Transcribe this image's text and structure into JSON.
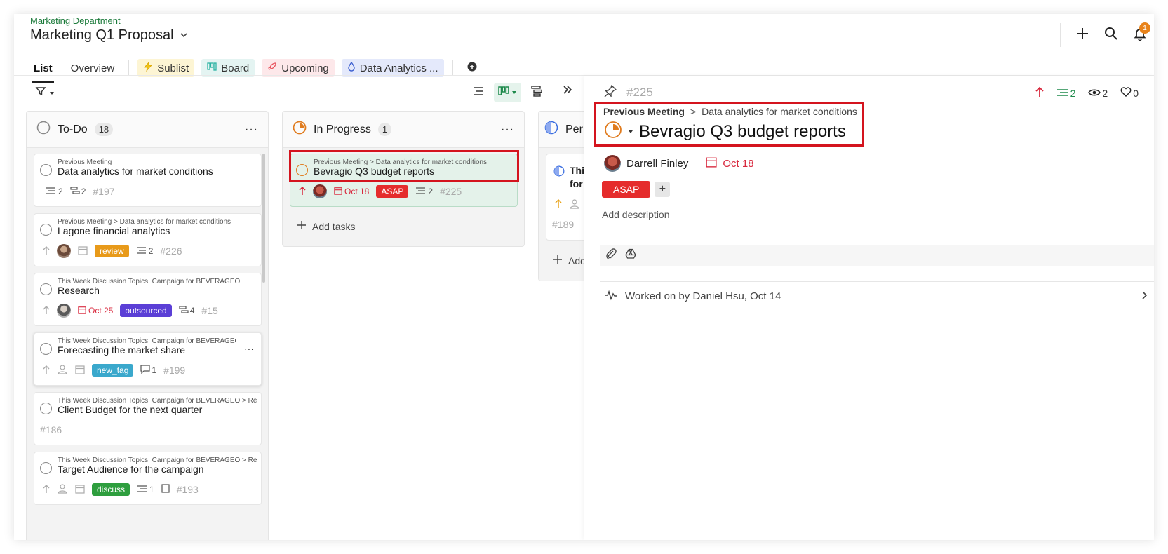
{
  "header": {
    "department": "Marketing Department",
    "project": "Marketing Q1 Proposal",
    "notification_count": "1"
  },
  "tabs": [
    {
      "label": "List"
    },
    {
      "label": "Overview"
    },
    {
      "label": "Sublist"
    },
    {
      "label": "Board"
    },
    {
      "label": "Upcoming"
    },
    {
      "label": "Data Analytics ..."
    }
  ],
  "columns": {
    "todo": {
      "title": "To-Do",
      "count": "18",
      "cards": [
        {
          "path": "Previous Meeting",
          "title": "Data analytics for market conditions",
          "subtasks": "2",
          "children": "2",
          "id": "#197"
        },
        {
          "path": "Previous Meeting > Data analytics for market conditions",
          "title": "Lagone financial analytics",
          "tag": "review",
          "subtasks": "2",
          "id": "#226"
        },
        {
          "path": "This Week Discussion Topics: Campaign for BEVERAGEO",
          "title": "Research",
          "date": "Oct 25",
          "tag": "outsourced",
          "children": "4",
          "id": "#15"
        },
        {
          "path": "This Week Discussion Topics: Campaign for BEVERAGEO > P...",
          "title": "Forecasting the market share",
          "tag": "new_tag",
          "comments": "1",
          "id": "#199"
        },
        {
          "path": "This Week Discussion Topics: Campaign for BEVERAGEO > Re...",
          "title": "Client Budget for the next quarter",
          "id": "#186"
        },
        {
          "path": "This Week Discussion Topics: Campaign for BEVERAGEO > Re...",
          "title": "Target Audience for the campaign",
          "tag": "discuss",
          "subtasks": "1",
          "id": "#193"
        }
      ]
    },
    "inprogress": {
      "title": "In Progress",
      "count": "1",
      "cards": [
        {
          "path": "Previous Meeting > Data analytics for market conditions",
          "title": "Bevragio Q3 budget reports",
          "date": "Oct 18",
          "tag": "ASAP",
          "subtasks": "2",
          "id": "#225"
        }
      ],
      "add_label": "Add tasks"
    },
    "pending": {
      "title": "Per",
      "card_title_line1": "Thi",
      "card_title_line2": "for",
      "card_id": "#189",
      "add_label": "Add"
    }
  },
  "detail": {
    "id": "#225",
    "subtasks": "2",
    "watchers": "2",
    "likes": "0",
    "crumb_parent": "Previous Meeting",
    "crumb_sep": ">",
    "crumb_task": "Data analytics for market conditions",
    "title": "Bevragio Q3 budget reports",
    "assignee": "Darrell Finley",
    "due": "Oct 18",
    "tag": "ASAP",
    "tag_add": "+",
    "description_placeholder": "Add description",
    "activity": "Worked on by Daniel Hsu, Oct 14"
  },
  "colors": {
    "department": "#1b7a3a",
    "review": "#e89a1a",
    "outsourced": "#5b3fd6",
    "new_tag": "#3aa8cc",
    "discuss": "#2e9e3e",
    "asap": "#e52c2c",
    "in_progress": "#e07b1e",
    "pending": "#3b6ee0",
    "highlight": "#d4141e"
  }
}
